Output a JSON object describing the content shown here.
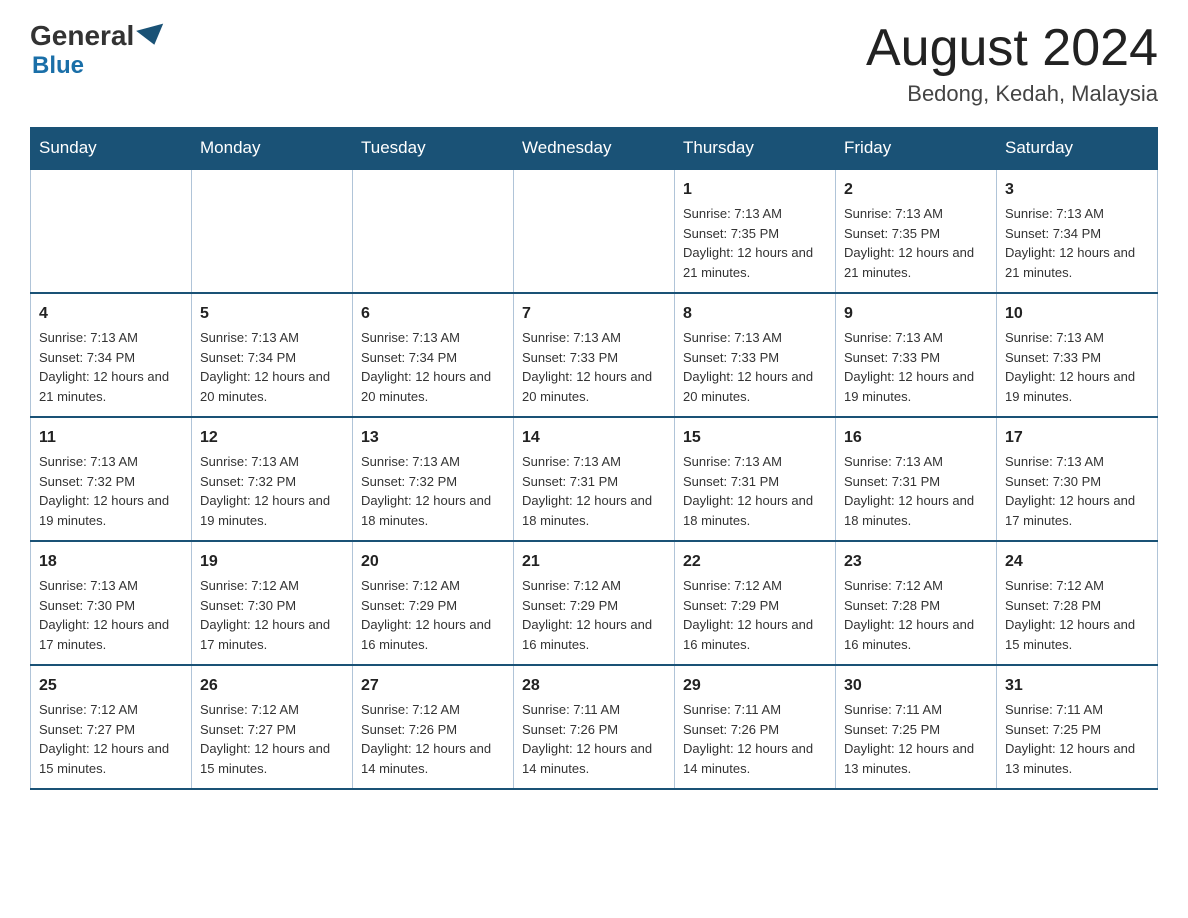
{
  "header": {
    "logo": {
      "general": "General",
      "blue": "Blue"
    },
    "title": "August 2024",
    "location": "Bedong, Kedah, Malaysia"
  },
  "days_of_week": [
    "Sunday",
    "Monday",
    "Tuesday",
    "Wednesday",
    "Thursday",
    "Friday",
    "Saturday"
  ],
  "weeks": [
    [
      {
        "day": "",
        "info": ""
      },
      {
        "day": "",
        "info": ""
      },
      {
        "day": "",
        "info": ""
      },
      {
        "day": "",
        "info": ""
      },
      {
        "day": "1",
        "info": "Sunrise: 7:13 AM\nSunset: 7:35 PM\nDaylight: 12 hours and 21 minutes."
      },
      {
        "day": "2",
        "info": "Sunrise: 7:13 AM\nSunset: 7:35 PM\nDaylight: 12 hours and 21 minutes."
      },
      {
        "day": "3",
        "info": "Sunrise: 7:13 AM\nSunset: 7:34 PM\nDaylight: 12 hours and 21 minutes."
      }
    ],
    [
      {
        "day": "4",
        "info": "Sunrise: 7:13 AM\nSunset: 7:34 PM\nDaylight: 12 hours and 21 minutes."
      },
      {
        "day": "5",
        "info": "Sunrise: 7:13 AM\nSunset: 7:34 PM\nDaylight: 12 hours and 20 minutes."
      },
      {
        "day": "6",
        "info": "Sunrise: 7:13 AM\nSunset: 7:34 PM\nDaylight: 12 hours and 20 minutes."
      },
      {
        "day": "7",
        "info": "Sunrise: 7:13 AM\nSunset: 7:33 PM\nDaylight: 12 hours and 20 minutes."
      },
      {
        "day": "8",
        "info": "Sunrise: 7:13 AM\nSunset: 7:33 PM\nDaylight: 12 hours and 20 minutes."
      },
      {
        "day": "9",
        "info": "Sunrise: 7:13 AM\nSunset: 7:33 PM\nDaylight: 12 hours and 19 minutes."
      },
      {
        "day": "10",
        "info": "Sunrise: 7:13 AM\nSunset: 7:33 PM\nDaylight: 12 hours and 19 minutes."
      }
    ],
    [
      {
        "day": "11",
        "info": "Sunrise: 7:13 AM\nSunset: 7:32 PM\nDaylight: 12 hours and 19 minutes."
      },
      {
        "day": "12",
        "info": "Sunrise: 7:13 AM\nSunset: 7:32 PM\nDaylight: 12 hours and 19 minutes."
      },
      {
        "day": "13",
        "info": "Sunrise: 7:13 AM\nSunset: 7:32 PM\nDaylight: 12 hours and 18 minutes."
      },
      {
        "day": "14",
        "info": "Sunrise: 7:13 AM\nSunset: 7:31 PM\nDaylight: 12 hours and 18 minutes."
      },
      {
        "day": "15",
        "info": "Sunrise: 7:13 AM\nSunset: 7:31 PM\nDaylight: 12 hours and 18 minutes."
      },
      {
        "day": "16",
        "info": "Sunrise: 7:13 AM\nSunset: 7:31 PM\nDaylight: 12 hours and 18 minutes."
      },
      {
        "day": "17",
        "info": "Sunrise: 7:13 AM\nSunset: 7:30 PM\nDaylight: 12 hours and 17 minutes."
      }
    ],
    [
      {
        "day": "18",
        "info": "Sunrise: 7:13 AM\nSunset: 7:30 PM\nDaylight: 12 hours and 17 minutes."
      },
      {
        "day": "19",
        "info": "Sunrise: 7:12 AM\nSunset: 7:30 PM\nDaylight: 12 hours and 17 minutes."
      },
      {
        "day": "20",
        "info": "Sunrise: 7:12 AM\nSunset: 7:29 PM\nDaylight: 12 hours and 16 minutes."
      },
      {
        "day": "21",
        "info": "Sunrise: 7:12 AM\nSunset: 7:29 PM\nDaylight: 12 hours and 16 minutes."
      },
      {
        "day": "22",
        "info": "Sunrise: 7:12 AM\nSunset: 7:29 PM\nDaylight: 12 hours and 16 minutes."
      },
      {
        "day": "23",
        "info": "Sunrise: 7:12 AM\nSunset: 7:28 PM\nDaylight: 12 hours and 16 minutes."
      },
      {
        "day": "24",
        "info": "Sunrise: 7:12 AM\nSunset: 7:28 PM\nDaylight: 12 hours and 15 minutes."
      }
    ],
    [
      {
        "day": "25",
        "info": "Sunrise: 7:12 AM\nSunset: 7:27 PM\nDaylight: 12 hours and 15 minutes."
      },
      {
        "day": "26",
        "info": "Sunrise: 7:12 AM\nSunset: 7:27 PM\nDaylight: 12 hours and 15 minutes."
      },
      {
        "day": "27",
        "info": "Sunrise: 7:12 AM\nSunset: 7:26 PM\nDaylight: 12 hours and 14 minutes."
      },
      {
        "day": "28",
        "info": "Sunrise: 7:11 AM\nSunset: 7:26 PM\nDaylight: 12 hours and 14 minutes."
      },
      {
        "day": "29",
        "info": "Sunrise: 7:11 AM\nSunset: 7:26 PM\nDaylight: 12 hours and 14 minutes."
      },
      {
        "day": "30",
        "info": "Sunrise: 7:11 AM\nSunset: 7:25 PM\nDaylight: 12 hours and 13 minutes."
      },
      {
        "day": "31",
        "info": "Sunrise: 7:11 AM\nSunset: 7:25 PM\nDaylight: 12 hours and 13 minutes."
      }
    ]
  ]
}
